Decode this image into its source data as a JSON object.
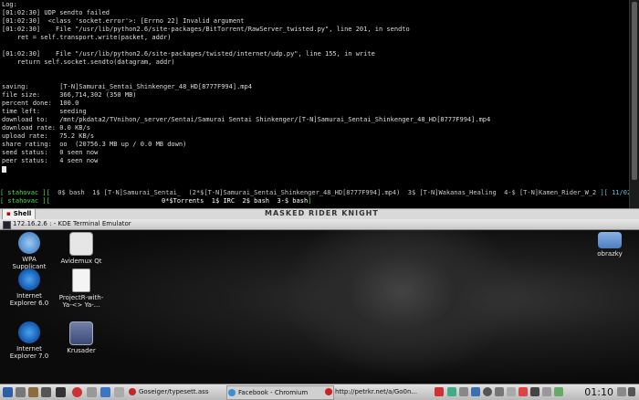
{
  "terminal": {
    "lines": [
      "Log:",
      "[01:02:30] UDP sendto failed",
      "[01:02:30]  <class 'socket.error'>: [Errno 22] Invalid argument",
      "[01:02:30]    File \"/usr/lib/python2.6/site-packages/BitTorrent/RawServer_twisted.py\", line 201, in sendto",
      "    ret = self.transport.write(packet, addr)",
      "",
      "[01:02:30]    File \"/usr/lib/python2.6/site-packages/twisted/internet/udp.py\", line 155, in write",
      "    return self.socket.sendto(datagram, addr)",
      "",
      "",
      "saving:        [T-N]Samurai_Sentai_Shinkenger_48_HD[8777F994].mp4",
      "file size:     366,714,302 (350 MB)",
      "percent done:  100.0",
      "time left:     seeding",
      "download to:   /mnt/pkdata2/TVnihon/_server/Sentai/Samurai Sentai Shinkenger/[T-N]Samurai_Sentai_Shinkenger_48_HD[8777F994].mp4",
      "download rate: 0.0 KB/s",
      "upload rate:   75.2 KB/s",
      "share rating:  oo  (20756.3 MB up / 0.0 MB down)",
      "seed status:   0 seen now",
      "peer status:   4 seen now"
    ],
    "screen_bar_1": {
      "host": "[ stahovac ][",
      "windows": "  0$ bash  1$ [T-N]Samurai_Sentai_  (2*$[T-N]Samurai_Sentai_Shinkenger_48_HD[8777F994].mp4)  3$ [T-N]Wakanas_Healing  4-$ [T-N]Kamen_Rider_W_2 ",
      "page": "][ 11/02  1:15 ]"
    },
    "screen_bar_2": {
      "host": "[ stahovac ][",
      "windows": "                             0*$Torrents  1$ IRC  2$ bash  3-$ bash",
      "page": "]"
    }
  },
  "tab": {
    "label": "Shell"
  },
  "window": {
    "title": "172.16.2.6 : - KDE Terminal Emulator",
    "banner": "MASKED RIDER KNIGHT"
  },
  "desktop_icons": [
    {
      "label": "WPA\nSupplicant",
      "icon": "wpa-icon"
    },
    {
      "label": "Avidemux Qt",
      "icon": "avidemux-icon"
    },
    {
      "label": "obrazky",
      "icon": "folder-image-icon"
    },
    {
      "label": "Internet\nExplorer 6.0",
      "icon": "ie-icon"
    },
    {
      "label": "ProjectR-with-\nYa-<> Ya-...",
      "icon": "document-icon"
    },
    {
      "label": "Internet\nExplorer 7.0",
      "icon": "ie-icon"
    },
    {
      "label": "Krusader",
      "icon": "krusader-icon"
    }
  ],
  "taskbar": {
    "tasks": [
      "Goseiger/typesett.ass",
      "Facebook - Chromium",
      "http://petrkr.net/a/Go0n..."
    ],
    "clock": "01:10"
  },
  "colors": {
    "terminal_bg": "#000000",
    "screen_green": "#55d855",
    "screen_cyan": "#58c4d8"
  }
}
